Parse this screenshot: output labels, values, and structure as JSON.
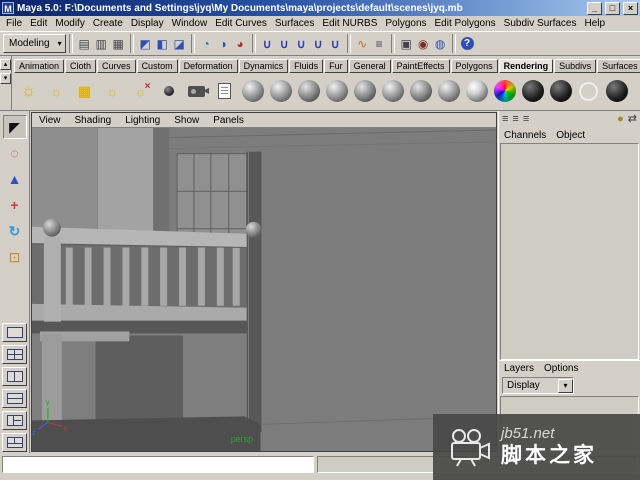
{
  "window": {
    "logo": "M",
    "title": "Maya 5.0: F:\\Documents and Settings\\jyq\\My Documents\\maya\\projects\\default\\scenes\\jyq.mb",
    "minimize": "_",
    "maximize": "□",
    "close": "×"
  },
  "menubar": {
    "items": [
      "File",
      "Edit",
      "Modify",
      "Create",
      "Display",
      "Window",
      "Edit Curves",
      "Surfaces",
      "Edit NURBS",
      "Polygons",
      "Edit Polygons",
      "Subdiv Surfaces",
      "Help"
    ]
  },
  "statusline": {
    "menu_set": "Modeling",
    "dropdown_arrow": "▾",
    "icons": [
      {
        "name": "new-scene-icon",
        "glyph": "▤"
      },
      {
        "name": "open-scene-icon",
        "glyph": "▥"
      },
      {
        "name": "save-scene-icon",
        "glyph": "▦"
      },
      {
        "name": "select-hierarchy-icon",
        "glyph": "◩"
      },
      {
        "name": "select-object-icon",
        "glyph": "◧"
      },
      {
        "name": "select-component-icon",
        "glyph": "◪"
      },
      {
        "name": "mask-hierarchy-icon",
        "glyph": "◔"
      },
      {
        "name": "mask-object-icon",
        "glyph": "◑"
      },
      {
        "name": "mask-component-icon",
        "glyph": "◕"
      },
      {
        "name": "snap-grid-icon",
        "glyph": "∪"
      },
      {
        "name": "snap-curve-icon",
        "glyph": "∪"
      },
      {
        "name": "snap-point-icon",
        "glyph": "∪"
      },
      {
        "name": "snap-plane-icon",
        "glyph": "∪"
      },
      {
        "name": "snap-live-icon",
        "glyph": "∪"
      },
      {
        "name": "construction-history-icon",
        "glyph": "∿"
      },
      {
        "name": "list-input-icon",
        "glyph": "≡"
      },
      {
        "name": "render-current-frame-icon",
        "glyph": "▣"
      },
      {
        "name": "ipr-render-icon",
        "glyph": "◉"
      },
      {
        "name": "render-globals-icon",
        "glyph": "◍"
      },
      {
        "name": "help-icon",
        "glyph": "?"
      }
    ]
  },
  "shelf": {
    "side_buttons": [
      {
        "name": "shelf-menu-up-icon",
        "glyph": "▴"
      },
      {
        "name": "shelf-menu-down-icon",
        "glyph": "▾"
      }
    ],
    "tabs": [
      "Animation",
      "Cloth",
      "Curves",
      "Custom",
      "Deformation",
      "Dynamics",
      "Fluids",
      "Fur",
      "General",
      "PaintEffects",
      "Polygons",
      "Rendering",
      "Subdivs",
      "Surfaces"
    ],
    "active_tab": "Rendering",
    "icons": [
      "point-light-icon",
      "ambient-light-icon",
      "area-light-icon",
      "spot-light-icon",
      "directional-light-icon",
      "volume-light-icon",
      "camera-icon",
      "render-view-icon",
      "lambert-material-icon",
      "blinn-material-icon",
      "phong-material-icon",
      "phonge-material-icon",
      "anisotropic-material-icon",
      "layered-shader-icon",
      "shading-map-icon",
      "surface-shader-icon",
      "env-ball-icon",
      "ramp-shader-icon",
      "volume-fog-icon",
      "particle-cloud-icon",
      "light-ring-icon",
      "black-hole-icon"
    ]
  },
  "toolbox": {
    "tools": [
      {
        "name": "select-tool",
        "glyph": "◤"
      },
      {
        "name": "lasso-tool",
        "glyph": "◌"
      },
      {
        "name": "translate-tool",
        "glyph": "▲"
      },
      {
        "name": "move-tool",
        "glyph": "+"
      },
      {
        "name": "rotate-tool",
        "glyph": "↻"
      },
      {
        "name": "scale-tool",
        "glyph": "⊡"
      }
    ],
    "layouts": [
      "single-pane",
      "four-pane",
      "two-pane-vertical",
      "two-pane-horizontal",
      "three-pane-left",
      "three-pane-bottom"
    ]
  },
  "viewport": {
    "menus": [
      "View",
      "Shading",
      "Lighting",
      "Show",
      "Panels"
    ],
    "camera_label": "persp",
    "axis_labels": {
      "x": "x",
      "y": "y",
      "z": "z"
    }
  },
  "channel_box": {
    "toolbar_icons": [
      {
        "name": "channel-layout-icon",
        "glyph": "≡"
      },
      {
        "name": "channel-layout-wide-icon",
        "glyph": "≡"
      },
      {
        "name": "channel-layout-narrow-icon",
        "glyph": "≡"
      },
      {
        "name": "manip-sphere-icon",
        "glyph": "●"
      },
      {
        "name": "show-hide-panel-icon",
        "glyph": "⇄"
      }
    ],
    "tabs": [
      "Channels",
      "Object"
    ]
  },
  "layer_editor": {
    "menus": [
      "Layers",
      "Options"
    ],
    "display_selector": "Display",
    "dropdown_arrow": "▾"
  },
  "command_line": {
    "value": ""
  },
  "watermark": {
    "site": "jb51.net",
    "name": "脚本之家"
  },
  "colors": {
    "titlebar_left": "#0a246a",
    "titlebar_right": "#a6caf0",
    "chrome": "#d4d0c8",
    "viewport_bg": "#7d7d7d",
    "panel_bg": "#cfccc4",
    "watermark_bg": "#484848"
  }
}
